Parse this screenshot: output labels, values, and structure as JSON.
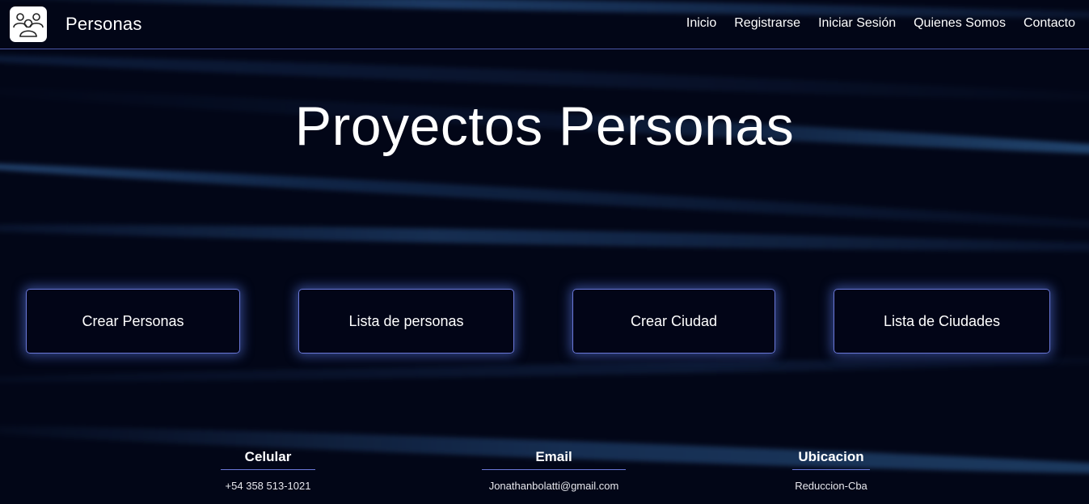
{
  "navbar": {
    "brand": "Personas",
    "links": [
      "Inicio",
      "Registrarse",
      "Iniciar Sesión",
      "Quienes Somos",
      "Contacto"
    ]
  },
  "hero": {
    "title": "Proyectos Personas"
  },
  "actions": [
    {
      "label": "Crear Personas"
    },
    {
      "label": "Lista de personas"
    },
    {
      "label": "Crear Ciudad"
    },
    {
      "label": "Lista de Ciudades"
    }
  ],
  "footer": {
    "columns": [
      {
        "heading": "Celular",
        "value": "+54 358 513-1021"
      },
      {
        "heading": "Email",
        "value": "Jonathanbolatti@gmail.com"
      },
      {
        "heading": "Ubicacion",
        "value": "Reduccion-Cba"
      }
    ]
  },
  "colors": {
    "background": "#020617",
    "accent_border": "#6a78d8",
    "glow": "#5a78e6"
  },
  "icons": {
    "logo": "people-group-icon"
  }
}
